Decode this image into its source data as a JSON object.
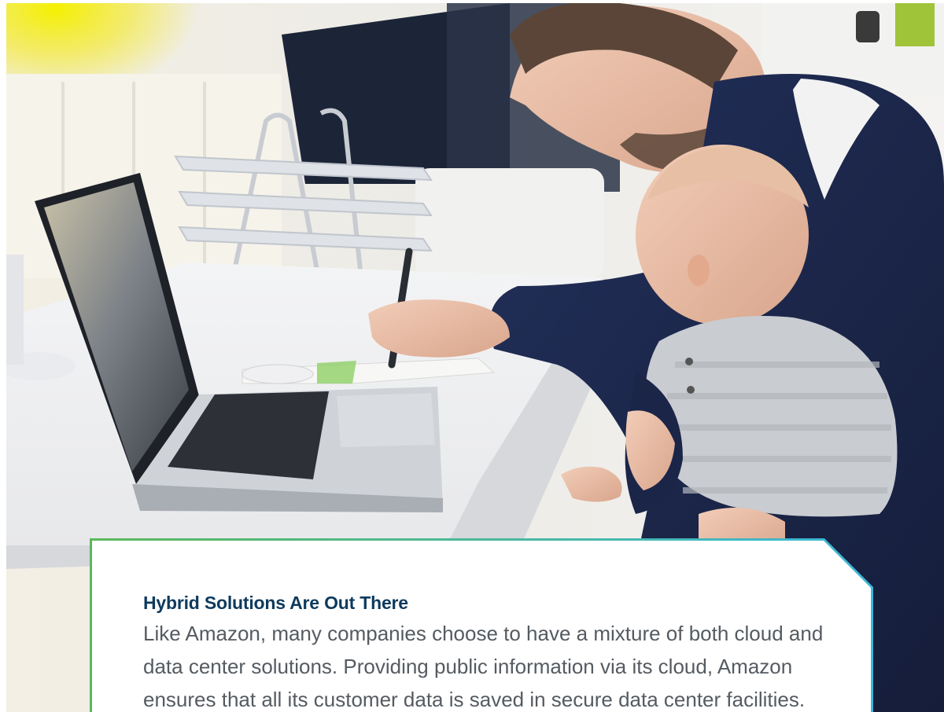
{
  "callout": {
    "heading": "Hybrid Solutions Are Out There",
    "body": "Like Amazon, many companies choose to have a mixture of both cloud and data center solutions. Providing public information via its cloud, Amazon ensures that all its customer data is saved in secure data center facilities."
  },
  "colors": {
    "heading": "#0e3a5d",
    "body_text": "#555b61",
    "border_start": "#5cb85c",
    "border_end": "#3cb8d8"
  },
  "hero_image": {
    "icon": "photo-father-baby-laptop"
  }
}
